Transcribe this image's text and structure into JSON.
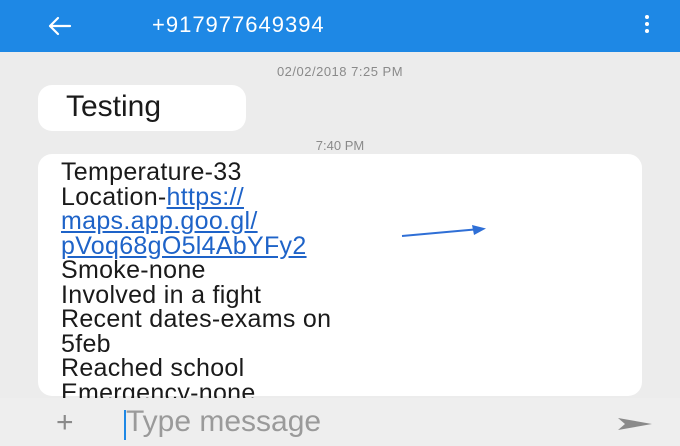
{
  "appbar": {
    "back_icon": "arrow-left-icon",
    "title": "+917977649394",
    "menu_icon": "more-vertical-icon",
    "color": "#1e88e5"
  },
  "conversation": {
    "messages": [
      {
        "timestamp": "02/02/2018 7:25 PM",
        "text": "Testing"
      },
      {
        "timestamp": "7:40 PM",
        "lines": {
          "temperature": "Temperature-33",
          "location_prefix": "Location-",
          "link_part1": "https://",
          "link_part2": "maps.app.goo.gl/",
          "link_part3": "pVoq68gO5l4AbYFy2",
          "smoke": "Smoke-none",
          "fight": "Involved in a fight",
          "dates": "Recent dates-exams on",
          "dates_cont": "5feb",
          "school": "Reached school",
          "emergency": "Emergency-none"
        }
      }
    ]
  },
  "composer": {
    "add_icon": "plus-icon",
    "add_glyph": "+",
    "placeholder": "Type message",
    "send_icon": "send-arrow-icon"
  }
}
